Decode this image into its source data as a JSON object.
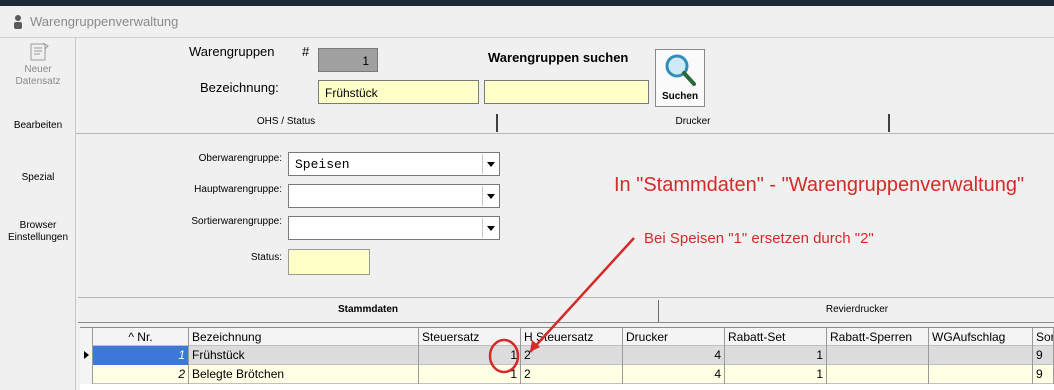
{
  "window": {
    "title": "Warengruppenverwaltung"
  },
  "sidebar": {
    "new_record_label": "Neuer\nDatensatz",
    "items": [
      {
        "label": "Bearbeiten"
      },
      {
        "label": "Spezial"
      },
      {
        "label": "Browser Einstellungen"
      }
    ]
  },
  "header": {
    "warengruppen_label": "Warengruppen",
    "hash_label": "#",
    "number_value": "1",
    "bezeichnung_label": "Bezeichnung:",
    "bezeichnung_value": "Frühstück",
    "search_title": "Warengruppen suchen",
    "search_value": "",
    "search_button_label": "Suchen"
  },
  "tabs_top": [
    {
      "label": "OHS / Status"
    },
    {
      "label": "Drucker"
    }
  ],
  "form": {
    "oberwarengruppe_label": "Oberwarengruppe:",
    "oberwarengruppe_value": "Speisen",
    "hauptwarengruppe_label": "Hauptwarengruppe:",
    "hauptwarengruppe_value": "",
    "sortierwarengruppe_label": "Sortierwarengruppe:",
    "sortierwarengruppe_value": "",
    "status_label": "Status:"
  },
  "annotations": {
    "main_note": "In \"Stammdaten\" - \"Warengruppenverwaltung\"",
    "sub_note": "Bei Speisen \"1\" ersetzen durch \"2\"",
    "accent_color": "#d42a2a"
  },
  "tabs_bottom": [
    {
      "label": "Stammdaten"
    },
    {
      "label": "Revierdrucker"
    }
  ],
  "table": {
    "columns": [
      "^ Nr.",
      "Bezeichnung",
      "Steuersatz",
      "H Steuersatz",
      "Drucker",
      "Rabatt-Set",
      "Rabatt-Sperren",
      "WGAufschlag",
      "Sor"
    ],
    "rows": [
      {
        "nr": "1",
        "bezeichnung": "Frühstück",
        "steuersatz": "1",
        "h_steuersatz": "2",
        "drucker": "4",
        "rabatt_set": "1",
        "rabatt_sperren": "",
        "wgaufschlag": "",
        "sor": "9"
      },
      {
        "nr": "2",
        "bezeichnung": "Belegte Brötchen",
        "steuersatz": "1",
        "h_steuersatz": "2",
        "drucker": "4",
        "rabatt_set": "1",
        "rabatt_sperren": "",
        "wgaufschlag": "",
        "sor": "9"
      }
    ]
  }
}
